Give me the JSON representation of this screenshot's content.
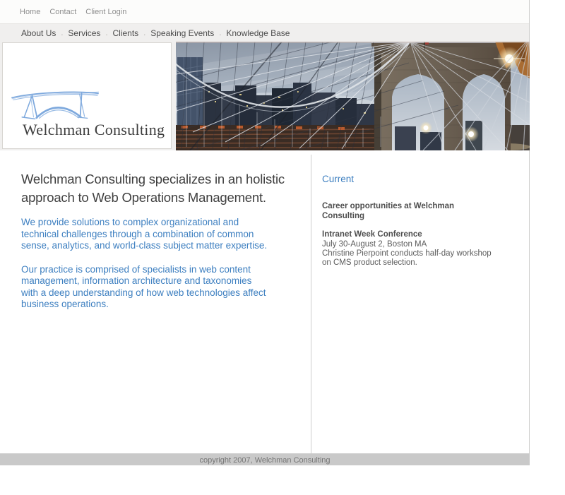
{
  "colors": {
    "accent_blue": "#3d7fc0",
    "nav_bg": "#f0efee",
    "footer_bg": "#c9c9c9",
    "logo_sketch_blue": "#7ea9dd",
    "headline_gray": "#3f3f3f"
  },
  "utility_nav": {
    "items": [
      {
        "label": "Home"
      },
      {
        "label": "Contact"
      },
      {
        "label": "Client Login"
      }
    ]
  },
  "main_nav": {
    "separator": ".",
    "items": [
      {
        "label": "About Us"
      },
      {
        "label": "Services"
      },
      {
        "label": "Clients"
      },
      {
        "label": "Speaking Events"
      },
      {
        "label": "Knowledge Base"
      }
    ]
  },
  "logo": {
    "company": "Welchman Consulting",
    "icon": "bridge-sketch-icon"
  },
  "hero": {
    "photo": "brooklyn-bridge-at-dusk-photo"
  },
  "main": {
    "headline_lines": [
      "Welchman Consulting specializes in an holistic",
      "approach to Web Operations Management."
    ],
    "paragraph1_lines": [
      "We provide solutions to complex organizational and",
      "technical challenges through a combination of common",
      "sense, analytics, and world-class subject matter expertise."
    ],
    "paragraph2_lines": [
      "Our practice is comprised of specialists in web content",
      "management, information architecture and taxonomies",
      "with a deep understanding of how web technologies affect",
      "business operations."
    ]
  },
  "sidebar": {
    "heading": "Current",
    "item1_title_lines": [
      "Career opportunities at Welchman",
      "Consulting"
    ],
    "item2_title": "Intranet Week Conference",
    "item2_lines": [
      "July 30-August 2, Boston MA",
      "Christine Pierpoint conducts half-day workshop",
      "on CMS product selection."
    ]
  },
  "footer": {
    "copyright": "copyright 2007, Welchman Consulting"
  }
}
